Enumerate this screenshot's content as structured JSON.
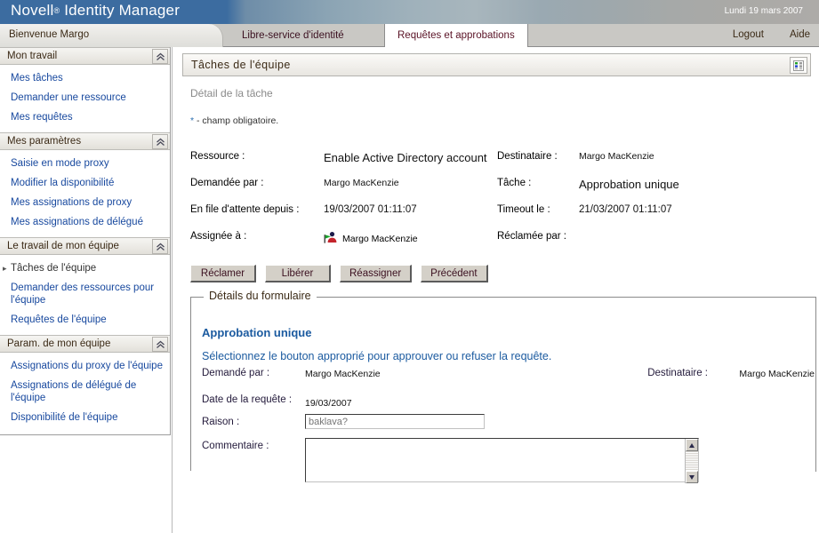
{
  "banner": {
    "product": "Novell",
    "registered": "®",
    "suite": "Identity Manager",
    "date": "Lundi 19 mars 2007"
  },
  "tabbar": {
    "welcome": "Bienvenue Margo",
    "tabs": [
      {
        "label": "Libre-service d'identité",
        "active": false
      },
      {
        "label": "Requêtes et approbations",
        "active": true
      }
    ],
    "logout": "Logout",
    "help": "Aide"
  },
  "sidebar": {
    "sections": [
      {
        "title": "Mon travail",
        "collapse_icon": "chevron-up-double-icon",
        "links": [
          {
            "label": "Mes tâches",
            "active": false
          },
          {
            "label": "Demander une ressource",
            "active": false
          },
          {
            "label": "Mes requêtes",
            "active": false
          }
        ]
      },
      {
        "title": "Mes paramètres",
        "collapse_icon": "chevron-up-double-icon",
        "links": [
          {
            "label": "Saisie en mode proxy",
            "active": false
          },
          {
            "label": "Modifier la disponibilité",
            "active": false
          },
          {
            "label": "Mes assignations de proxy",
            "active": false
          },
          {
            "label": "Mes assignations de délégué",
            "active": false
          }
        ]
      },
      {
        "title": "Le travail de mon équipe",
        "collapse_icon": "chevron-up-double-icon",
        "links": [
          {
            "label": "Tâches de l'équipe",
            "active": true
          },
          {
            "label": "Demander des ressources pour l'équipe",
            "active": false
          },
          {
            "label": "Requêtes de l'équipe",
            "active": false
          }
        ]
      },
      {
        "title": "Param. de mon équipe",
        "collapse_icon": "chevron-up-double-icon",
        "links": [
          {
            "label": "Assignations du proxy de l'équipe",
            "active": false
          },
          {
            "label": "Assignations de délégué de l'équipe",
            "active": false
          },
          {
            "label": "Disponibilité de l'équipe",
            "active": false
          }
        ]
      }
    ]
  },
  "content": {
    "panel_title": "Tâches de l'équipe",
    "grid_icon": "grid-view-icon",
    "subtitle": "Détail de la tâche",
    "required_star": "*",
    "required_note": " - champ obligatoire.",
    "details": {
      "left": [
        {
          "label": "Ressource :",
          "value": "Enable Active Directory account"
        },
        {
          "label": "Demandée par :",
          "value": "Margo MacKenzie"
        },
        {
          "label": "En file d'attente depuis :",
          "value": "19/03/2007 01:11:07"
        },
        {
          "label": "Assignée à :",
          "value": "Margo MacKenzie"
        }
      ],
      "right": [
        {
          "label": "Destinataire :",
          "value": "Margo MacKenzie"
        },
        {
          "label": "Tâche :",
          "value": "Approbation unique"
        },
        {
          "label": "Timeout le :",
          "value": "21/03/2007 01:11:07"
        },
        {
          "label": "Réclamée par :",
          "value": ""
        }
      ],
      "assignee_icon": "user-flag-icon"
    },
    "buttons": [
      {
        "label": "Réclamer"
      },
      {
        "label": "Libérer"
      },
      {
        "label": "Réassigner"
      },
      {
        "label": "Précédent"
      }
    ],
    "form": {
      "legend": "Détails du formulaire",
      "title": "Approbation unique",
      "instruction": "Sélectionnez le bouton approprié pour approuver ou refuser la requête.",
      "requested_by_label": "Demandé par :",
      "requested_by_value": "Margo MacKenzie",
      "recipient_label": "Destinataire :",
      "recipient_value": "Margo MacKenzie",
      "request_date_label": "Date de la requête :",
      "request_date_value": "19/03/2007",
      "reason_label": "Raison :",
      "reason_value": "",
      "reason_placeholder": "baklava?",
      "comment_label": "Commentaire :",
      "comment_value": "",
      "scroll_up_icon": "scroll-up-arrow-icon",
      "scroll_down_icon": "scroll-down-arrow-icon"
    }
  },
  "colors": {
    "banner_blue": "#3c6ca0",
    "link_blue": "#17489e",
    "form_heading_blue": "#1c5ba0",
    "button_face": "#d4d0c8"
  }
}
